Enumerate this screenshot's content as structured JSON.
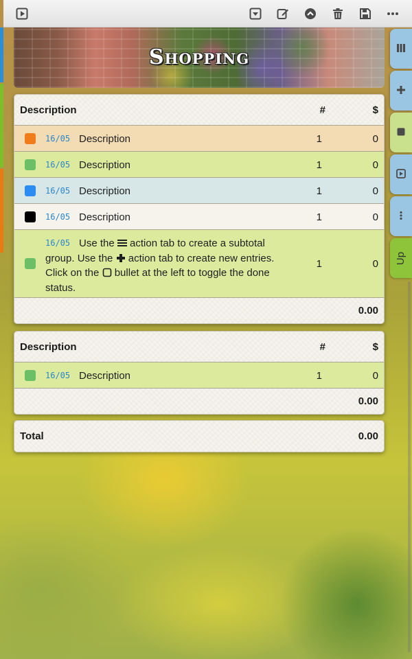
{
  "banner": {
    "title": "Shopping"
  },
  "toolbar": {
    "icons": [
      "play-icon",
      "dropdown-icon",
      "edit-icon",
      "up-icon",
      "trash-icon",
      "save-icon",
      "more-icon"
    ]
  },
  "side_tabs": {
    "up_label": "Up"
  },
  "groups": [
    {
      "header": {
        "description": "Description",
        "qty": "#",
        "price": "$"
      },
      "items": [
        {
          "date": "16/05",
          "description": "Description",
          "qty": "1",
          "price": "0",
          "bullet_color": "#f07c1a",
          "row_color": "#f3dbb4"
        },
        {
          "date": "16/05",
          "description": "Description",
          "qty": "1",
          "price": "0",
          "bullet_color": "#6bc067",
          "row_color": "#dcea9e"
        },
        {
          "date": "16/05",
          "description": "Description",
          "qty": "1",
          "price": "0",
          "bullet_color": "#2b8cf2",
          "row_color": "#d7e6e6"
        },
        {
          "date": "16/05",
          "description": "Description",
          "qty": "1",
          "price": "0",
          "bullet_color": "#000000",
          "row_color": "#f5f3ec"
        }
      ],
      "help_item": {
        "date": "16/05",
        "text_1": "Use the",
        "text_2": "action tab to create a subtotal group. Use the",
        "text_3": "action tab to create new entries. Click on the",
        "text_4": "bullet at the left to toggle the done status.",
        "qty": "1",
        "price": "0",
        "bullet_color": "#6bc067",
        "row_color": "#dcea9e"
      },
      "subtotal": "0.00"
    },
    {
      "header": {
        "description": "Description",
        "qty": "#",
        "price": "$"
      },
      "items": [
        {
          "date": "16/05",
          "description": "Description",
          "qty": "1",
          "price": "0",
          "bullet_color": "#6bc067",
          "row_color": "#dcea9e"
        }
      ],
      "subtotal": "0.00"
    }
  ],
  "total": {
    "label": "Total",
    "amount": "0.00"
  }
}
